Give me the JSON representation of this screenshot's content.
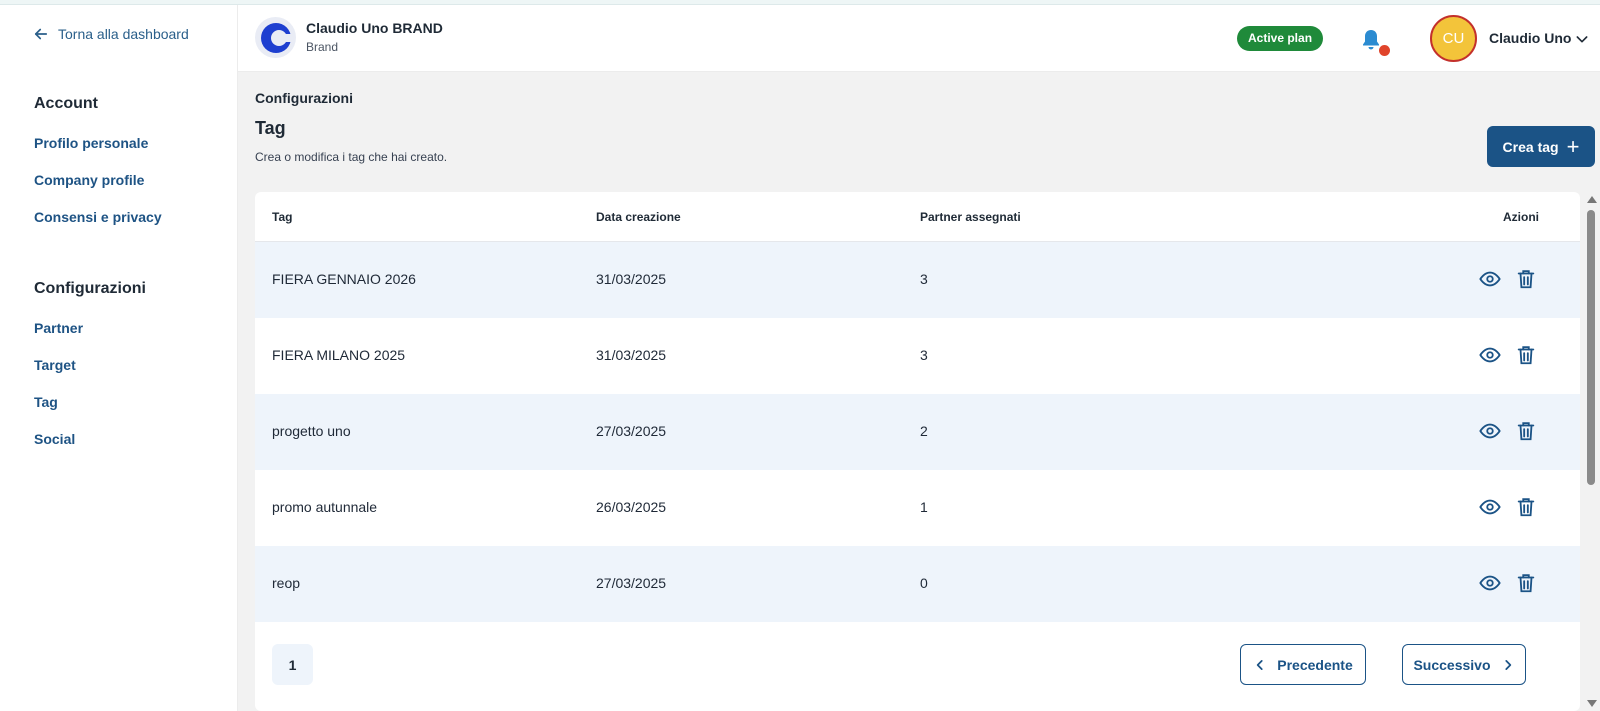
{
  "sidebar": {
    "back_label": "Torna alla dashboard",
    "sections": [
      {
        "heading": "Account",
        "items": [
          "Profilo personale",
          "Company profile",
          "Consensi e privacy"
        ]
      },
      {
        "heading": "Configurazioni",
        "items": [
          "Partner",
          "Target",
          "Tag",
          "Social"
        ]
      }
    ]
  },
  "header": {
    "brand_name": "Claudio Uno BRAND",
    "brand_sub": "Brand",
    "plan_badge": "Active plan",
    "avatar_initials": "CU",
    "user_name": "Claudio Uno"
  },
  "main": {
    "breadcrumb": "Configurazioni",
    "title": "Tag",
    "description": "Crea o modifica i tag che hai creato.",
    "create_button": "Crea tag",
    "columns": [
      "Tag",
      "Data creazione",
      "Partner assegnati",
      "Azioni"
    ],
    "rows": [
      {
        "tag": "FIERA GENNAIO 2026",
        "date": "31/03/2025",
        "partners": "3"
      },
      {
        "tag": "FIERA MILANO 2025",
        "date": "31/03/2025",
        "partners": "3"
      },
      {
        "tag": "progetto uno",
        "date": "27/03/2025",
        "partners": "2"
      },
      {
        "tag": "promo autunnale",
        "date": "26/03/2025",
        "partners": "1"
      },
      {
        "tag": "reop",
        "date": "27/03/2025",
        "partners": "0"
      }
    ],
    "pagination": {
      "current_page": "1",
      "prev_label": "Precedente",
      "next_label": "Successivo"
    }
  },
  "colors": {
    "primary": "#1b5386",
    "success": "#1f8a3a",
    "row_alt": "#eef4fb",
    "avatar": "#f3c43a"
  },
  "icons": [
    "arrow-left-icon",
    "bell-icon",
    "chevron-down-icon",
    "plus-icon",
    "eye-icon",
    "trash-icon",
    "chevron-left-icon",
    "chevron-right-icon"
  ]
}
